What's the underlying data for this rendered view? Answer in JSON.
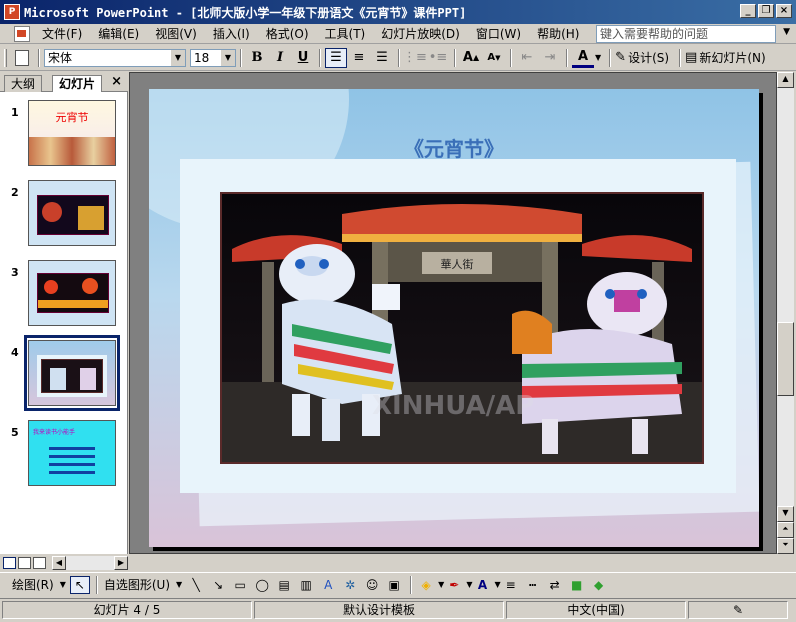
{
  "window": {
    "title": "Microsoft PowerPoint - [北师大版小学一年级下册语文《元宵节》课件PPT]",
    "app_icon_label": "P",
    "minimize": "_",
    "restore": "❐",
    "close": "×"
  },
  "menu": {
    "items": [
      "文件(F)",
      "编辑(E)",
      "视图(V)",
      "插入(I)",
      "格式(O)",
      "工具(T)",
      "幻灯片放映(D)",
      "窗口(W)",
      "帮助(H)"
    ],
    "help_placeholder": "键入需要帮助的问题"
  },
  "toolbar": {
    "font_name": "宋体",
    "font_size": "18",
    "bold": "B",
    "italic": "I",
    "underline": "U",
    "grow_font": "A",
    "shrink_font": "A",
    "font_color": "A",
    "design_label": "设计(S)",
    "new_slide_label": "新幻灯片(N)"
  },
  "left_pane": {
    "tab_outline": "大纲",
    "tab_slides": "幻灯片",
    "close": "×",
    "slides": [
      {
        "number": "1",
        "thumb_title": "元宵节"
      },
      {
        "number": "2"
      },
      {
        "number": "3"
      },
      {
        "number": "4"
      },
      {
        "number": "5",
        "thumb_title": "我来读书小能手"
      }
    ],
    "selected_slide": 4
  },
  "slide": {
    "title": "《元宵节》",
    "photo_gate_sign": "華人街",
    "photo_watermark": "XINHUA/AP"
  },
  "drawbar": {
    "draw_label": "绘图(R)",
    "autoshape_label": "自选图形(U)"
  },
  "status": {
    "slide_pos": "幻灯片 4 / 5",
    "template": "默认设计模板",
    "language": "中文(中国)"
  },
  "colors": {
    "titlebar_start": "#0a246a",
    "titlebar_end": "#3a6ea5",
    "slide_title": "#3a6fb8",
    "selection": "#0a246a"
  }
}
